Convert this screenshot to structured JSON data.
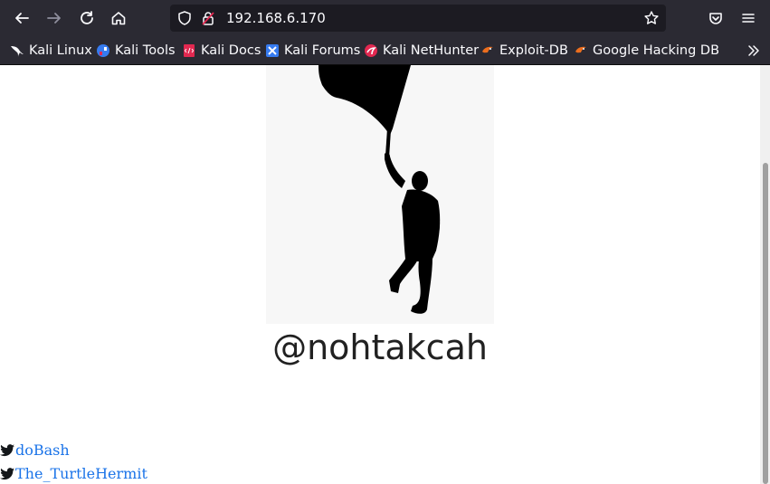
{
  "browser": {
    "url": "192.168.6.170",
    "icons": [
      "back-icon",
      "forward-icon",
      "reload-icon",
      "home-icon",
      "shield-icon",
      "insecure-lock-icon",
      "bookmark-star-icon",
      "pocket-icon",
      "menu-icon",
      "chevron-double-right-icon"
    ]
  },
  "bookmarks": [
    {
      "label": "Kali Linux"
    },
    {
      "label": "Kali Tools"
    },
    {
      "label": "Kali Docs"
    },
    {
      "label": "Kali Forums"
    },
    {
      "label": "Kali NetHunter"
    },
    {
      "label": "Exploit-DB"
    },
    {
      "label": "Google Hacking DB"
    }
  ],
  "page": {
    "handle": "@nohtakcah",
    "links": [
      {
        "text": "doBash"
      },
      {
        "text": "The_TurtleHermit"
      }
    ]
  },
  "colors": {
    "toolbar": "#2b2a33",
    "urlbar": "#1c1b22",
    "link": "#1a73e8",
    "handle": "#212121"
  }
}
